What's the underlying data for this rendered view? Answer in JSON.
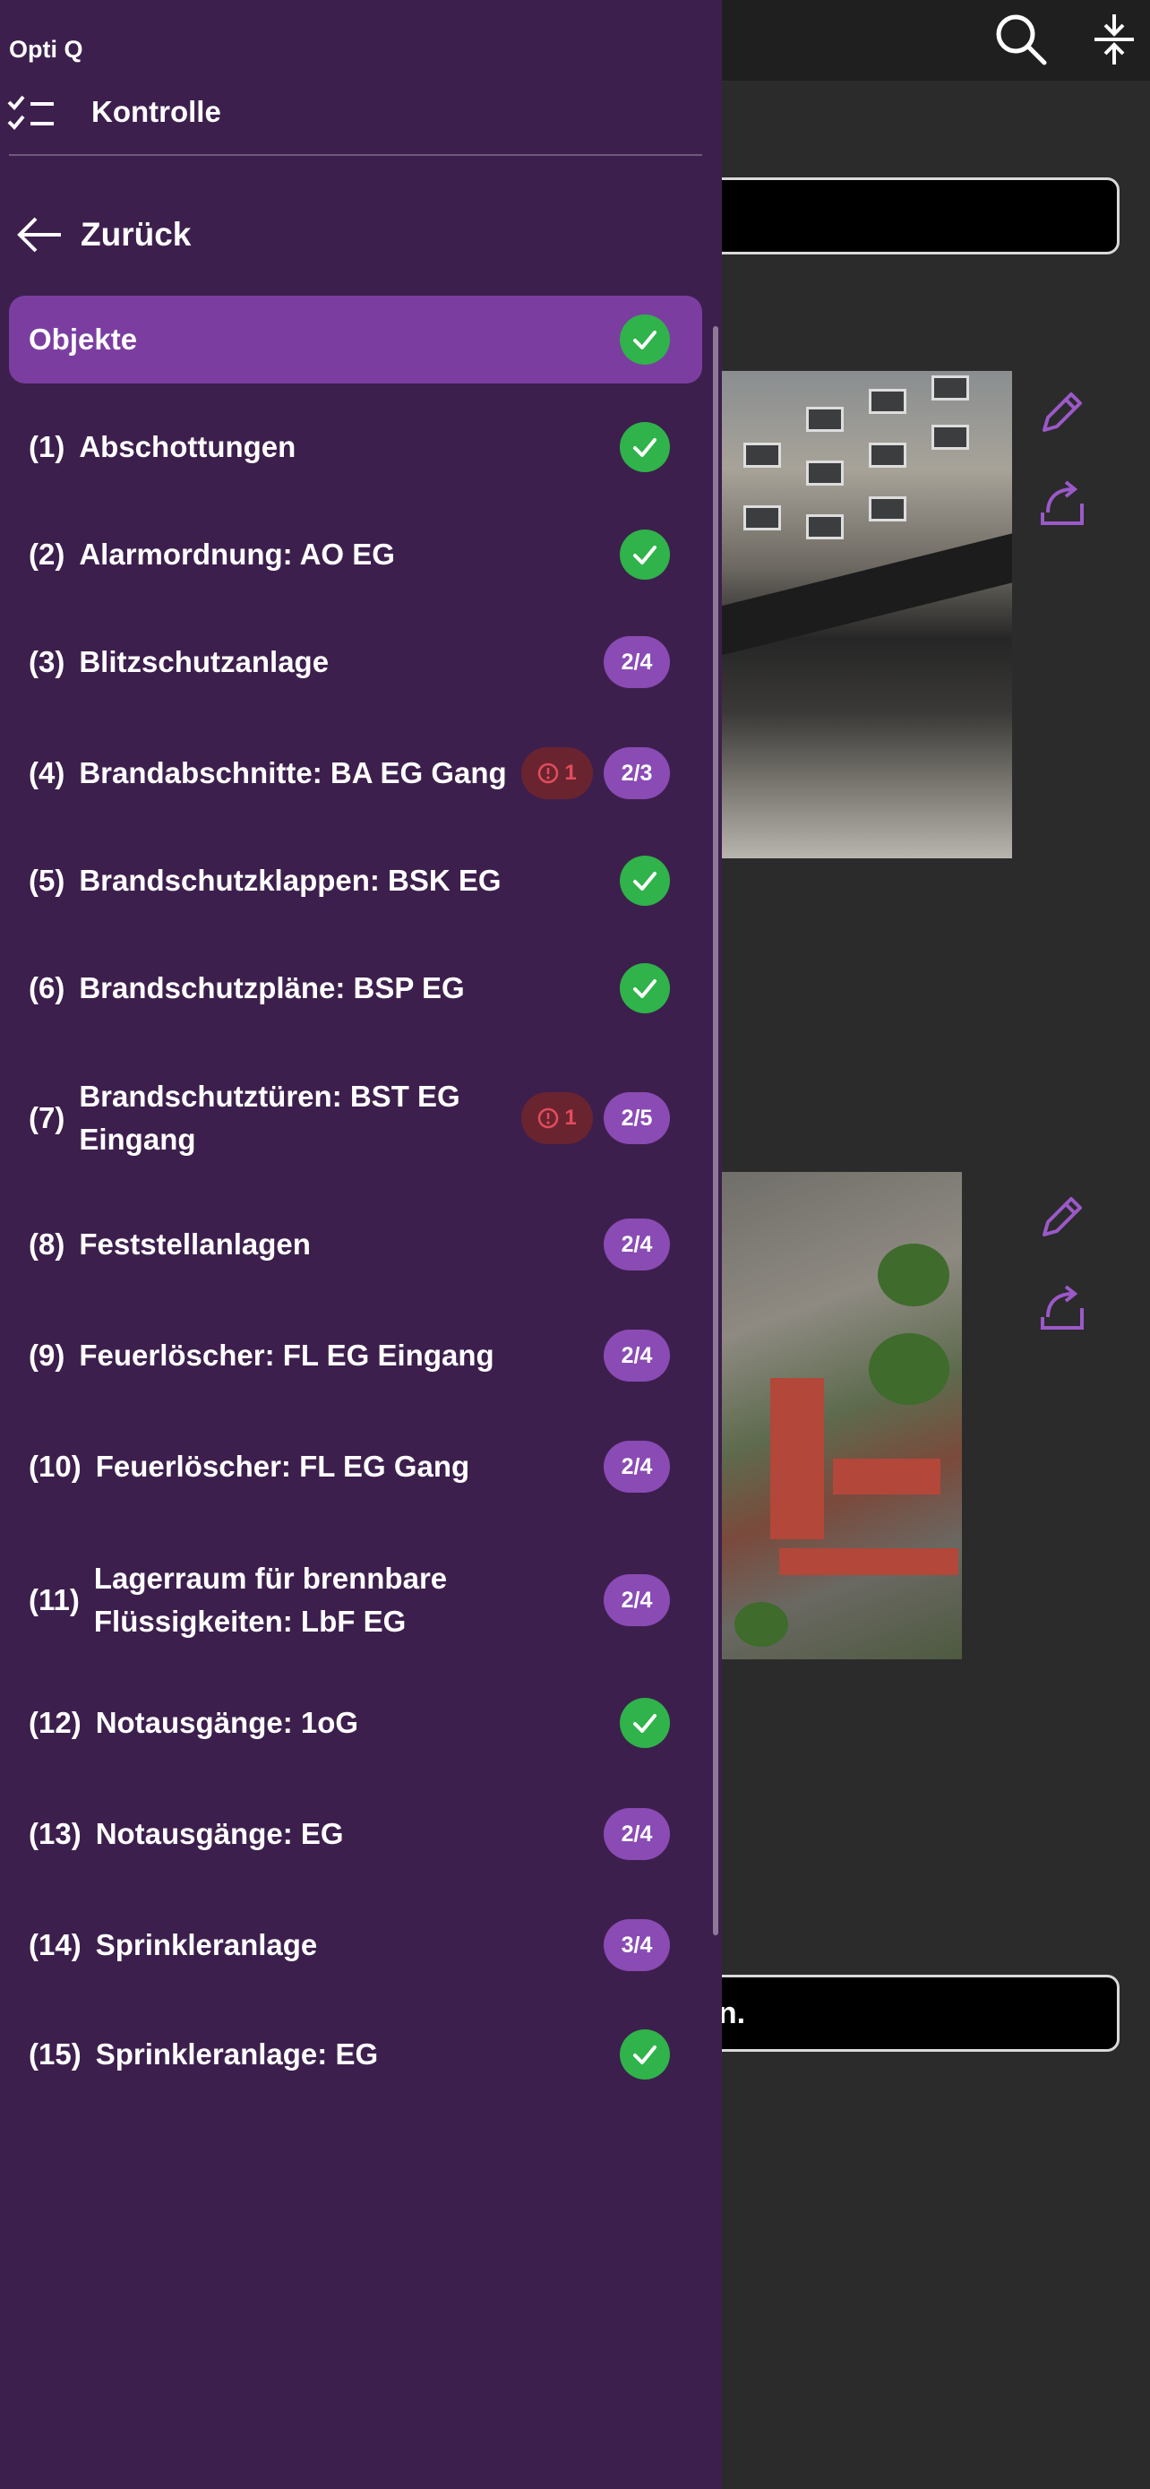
{
  "app": {
    "name": "Opti Q"
  },
  "drawer": {
    "section_title": "Kontrolle",
    "back_label": "Zurück",
    "items": [
      {
        "num": "",
        "label": "Objekte",
        "status": "done",
        "active": true
      },
      {
        "num": "(1)",
        "label": "Abschottungen",
        "status": "done"
      },
      {
        "num": "(2)",
        "label": "Alarmordnung: AO EG",
        "status": "done"
      },
      {
        "num": "(3)",
        "label": "Blitzschutzanlage",
        "progress": "2/4"
      },
      {
        "num": "(4)",
        "label": "Brandabschnitte: BA EG Gang",
        "alert": "1",
        "progress": "2/3"
      },
      {
        "num": "(5)",
        "label": "Brandschutzklappen: BSK EG",
        "status": "done"
      },
      {
        "num": "(6)",
        "label": "Brandschutzpläne: BSP EG",
        "status": "done"
      },
      {
        "num": "(7)",
        "label": "Brandschutztüren: BST EG Eingang",
        "alert": "1",
        "progress": "2/5"
      },
      {
        "num": "(8)",
        "label": "Feststellanlagen",
        "progress": "2/4"
      },
      {
        "num": "(9)",
        "label": "Feuerlöscher: FL EG Eingang",
        "progress": "2/4"
      },
      {
        "num": "(10)",
        "label": "Feuerlöscher: FL EG Gang",
        "progress": "2/4"
      },
      {
        "num": "(11)",
        "label": "Lagerraum für brennbare Flüssigkeiten: LbF EG",
        "progress": "2/4"
      },
      {
        "num": "(12)",
        "label": "Notausgänge: 1oG",
        "status": "done"
      },
      {
        "num": "(13)",
        "label": "Notausgänge: EG",
        "progress": "2/4"
      },
      {
        "num": "(14)",
        "label": "Sprinkleranlage",
        "progress": "3/4"
      },
      {
        "num": "(15)",
        "label": "Sprinkleranlage: EG",
        "status": "done"
      }
    ]
  },
  "background": {
    "bottom_box_text": "en.",
    "icons": [
      "search-icon",
      "collapse-icon",
      "edit-icon",
      "share-icon"
    ]
  },
  "colors": {
    "drawer_bg": "#3d1f4d",
    "active_item": "#7b3ea0",
    "progress_badge": "#8a4bb5",
    "done_badge": "#2fb34a",
    "alert_badge": "#6a2430",
    "accent_icon": "#9b59c9"
  }
}
